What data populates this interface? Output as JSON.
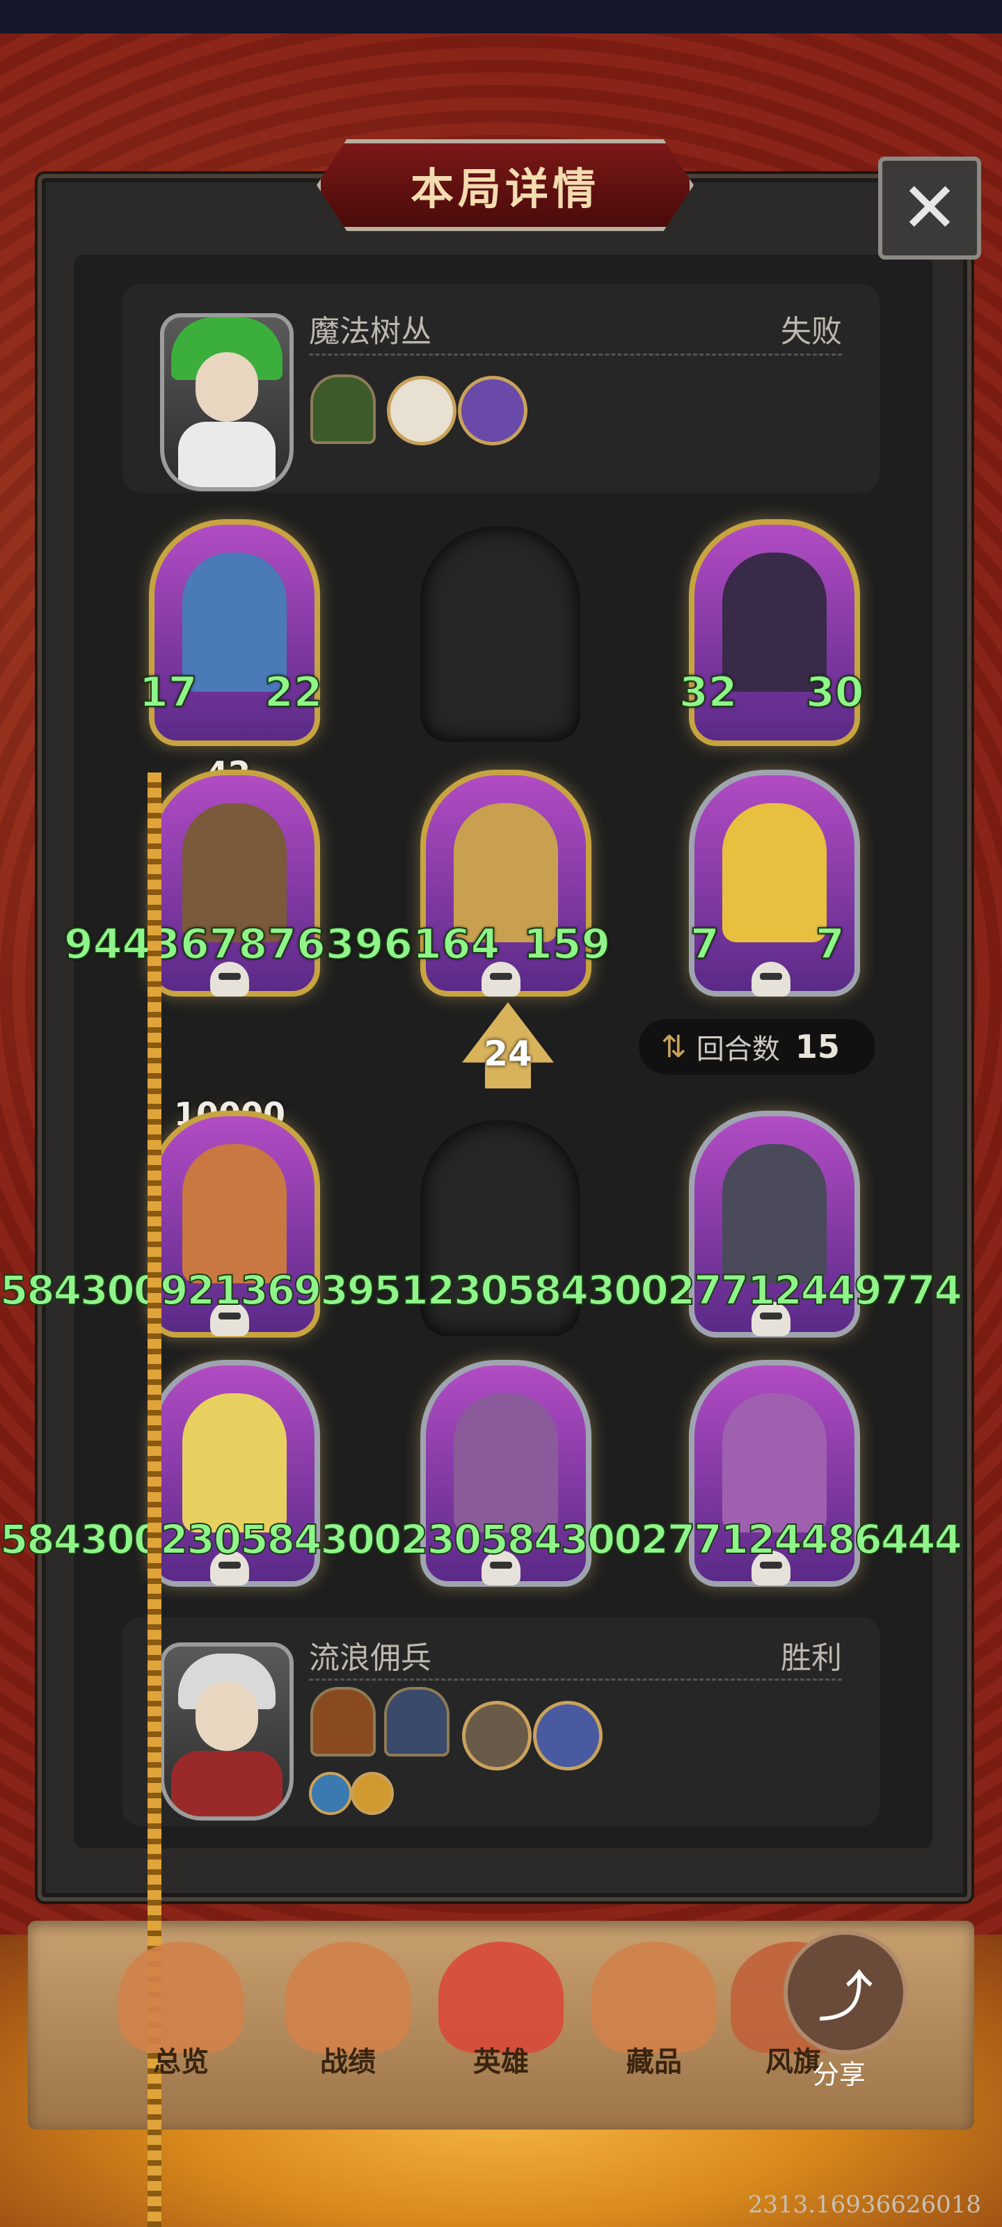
{
  "title": "本局详情",
  "close_icon": "close-icon",
  "top_player": {
    "name": "魔法树丛",
    "result": "失败",
    "items": [
      "green-door-item-icon",
      "compass-item-icon",
      "purple-book-item-icon"
    ]
  },
  "bottom_player": {
    "name": "流浪佣兵",
    "result": "胜利",
    "items": [
      "fire-door-item-icon",
      "storm-door-item-icon",
      "beast-item-icon",
      "cloud-item-icon"
    ],
    "skills": [
      "sword-skill-icon",
      "claw-skill-icon"
    ]
  },
  "top_board": {
    "row1": [
      {
        "attack": "17",
        "health": "22"
      },
      null,
      {
        "attack": "32",
        "health": "30"
      }
    ],
    "row2": {
      "unit1_tag": "42",
      "overflow_text": "944367876396164",
      "unit2_health": "159",
      "unit3_attack": "7",
      "unit3_health": "7"
    }
  },
  "center": {
    "arrow_value": "24",
    "turn_label": "回合数",
    "turn_value": "15"
  },
  "bottom_board": {
    "row1": {
      "unit1_tag": "10000",
      "overflow_text": "584300921369395123058430027712449774"
    },
    "row2": {
      "overflow_text": "584300230584300230584300277124486444"
    }
  },
  "nav": {
    "items": [
      "总览",
      "战绩",
      "英雄",
      "藏品",
      "风旗"
    ],
    "share": "分享"
  },
  "footer_id": "2313.16936626018"
}
